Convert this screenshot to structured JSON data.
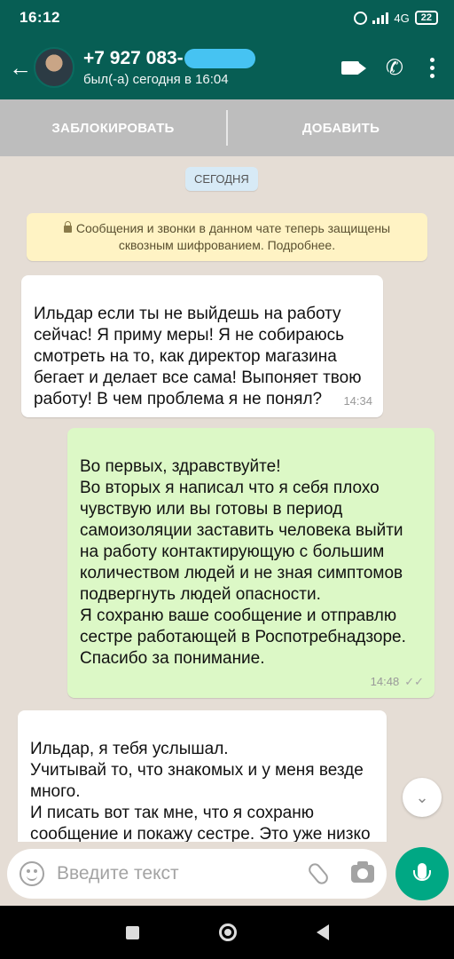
{
  "status_bar": {
    "time": "16:12",
    "network": "4G",
    "battery": "22"
  },
  "header": {
    "back_icon": "arrow-left-icon",
    "contact_number": "+7 927 083-",
    "last_seen": "был(-а) сегодня в 16:04",
    "icons": [
      "video-call-icon",
      "phone-icon",
      "more-vert-icon"
    ]
  },
  "contact_actions": {
    "block_label": "ЗАБЛОКИРОВАТЬ",
    "add_label": "ДОБАВИТЬ"
  },
  "chat": {
    "date_label": "СЕГОДНЯ",
    "encryption_notice": "Сообщения и звонки в данном чате теперь защищены сквозным шифрованием. Подробнее.",
    "messages": [
      {
        "direction": "incoming",
        "text": "Ильдар если ты не выйдешь на работу сейчас! Я приму меры! Я не собираюсь смотреть на то, как директор магазина бегает и делает все сама! Выпоняет твою работу! В чем проблема я не понял?",
        "time": "14:34"
      },
      {
        "direction": "outgoing",
        "text": "Во первых, здравствуйте!\nВо вторых я написал что я себя плохо чувствую или вы готовы в период самоизоляции заставить человека выйти на работу контактирующую с большим количеством людей и не зная симптомов подвергнуть  людей опасности.\nЯ сохраню ваше сообщение и отправлю сестре работающей в Роспотребнадзоре.\nСпасибо за понимание.",
        "time": "14:48",
        "ticks": "✓✓"
      },
      {
        "direction": "incoming",
        "text": "Ильдар, я тебя услышал.\nУчитывай то, что знакомых и у меня везде много.\nИ писать вот так мне, что я сохраню сообщение и покажу сестре. Это уже низко мне кажется. И уж точно не по",
        "time": ""
      }
    ]
  },
  "input": {
    "placeholder": "Введите текст",
    "icons": [
      "emoji-icon",
      "attach-icon",
      "camera-icon",
      "mic-icon"
    ]
  },
  "colors": {
    "header": "#075e54",
    "outgoing_bubble": "#dcf8c6",
    "incoming_bubble": "#ffffff",
    "chat_background": "#e5ddd5",
    "mic_button": "#00a884"
  }
}
